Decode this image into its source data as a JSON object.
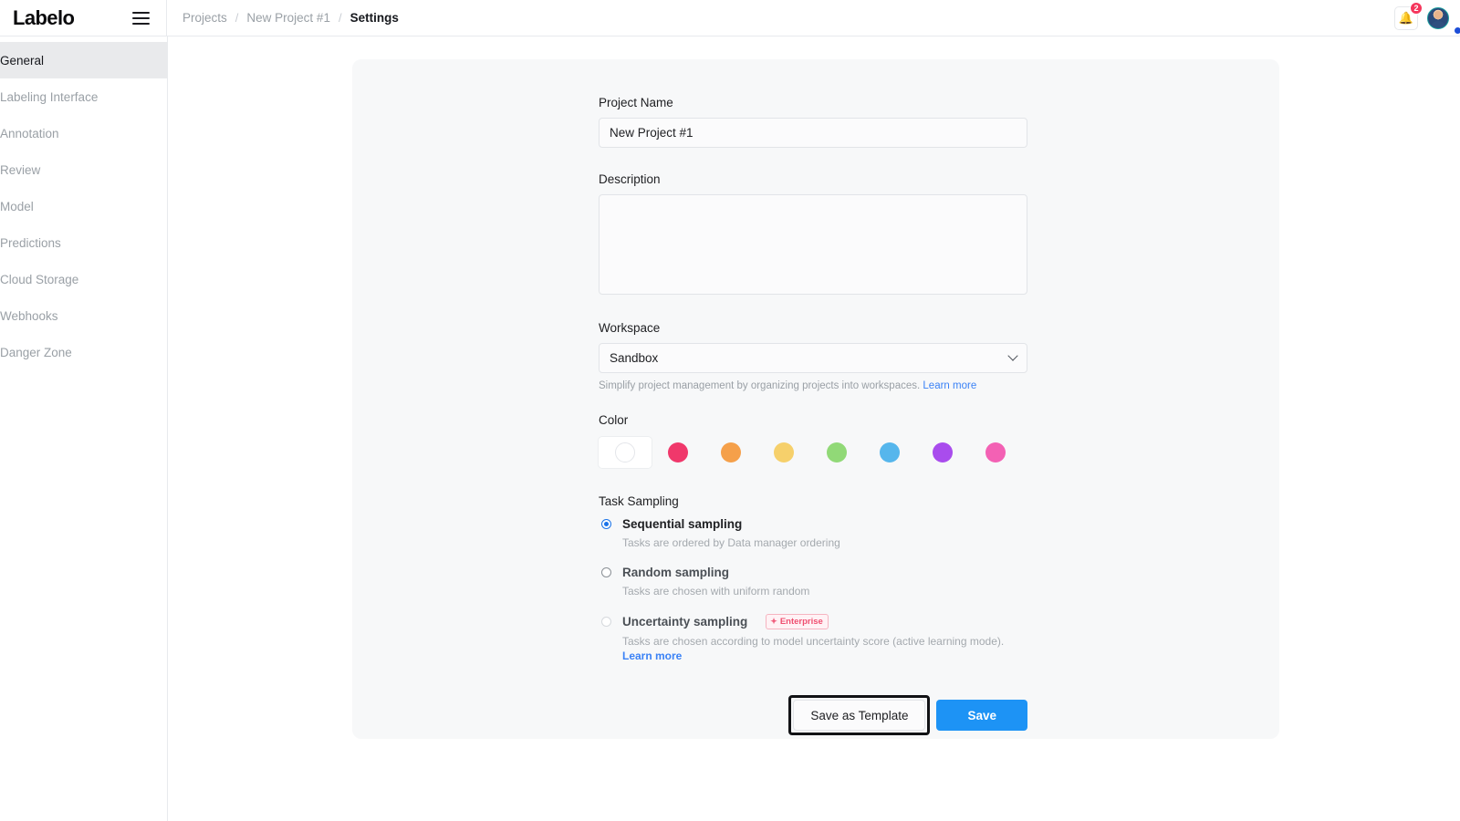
{
  "app": {
    "logo_text": "Labelo",
    "menu_icon": "hamburger-icon"
  },
  "breadcrumb": {
    "items": [
      {
        "label": "Projects",
        "current": false
      },
      {
        "label": "New Project #1",
        "current": false
      },
      {
        "label": "Settings",
        "current": true
      }
    ],
    "separator": "/"
  },
  "topbar": {
    "notifications_count": "2",
    "bell_icon": "bell-icon",
    "avatar_label": "user-avatar"
  },
  "sidebar": {
    "items": [
      {
        "label": "General",
        "active": true
      },
      {
        "label": "Labeling Interface",
        "active": false
      },
      {
        "label": "Annotation",
        "active": false
      },
      {
        "label": "Review",
        "active": false
      },
      {
        "label": "Model",
        "active": false
      },
      {
        "label": "Predictions",
        "active": false
      },
      {
        "label": "Cloud Storage",
        "active": false
      },
      {
        "label": "Webhooks",
        "active": false
      },
      {
        "label": "Danger Zone",
        "active": false
      }
    ]
  },
  "form": {
    "project_name": {
      "label": "Project Name",
      "value": "New Project #1",
      "placeholder": ""
    },
    "description": {
      "label": "Description",
      "value": "",
      "placeholder": ""
    },
    "workspace": {
      "label": "Workspace",
      "selected": "Sandbox",
      "options": [
        "Sandbox"
      ],
      "hint_text": "Simplify project management by organizing projects into workspaces.",
      "hint_link": "Learn more"
    },
    "color": {
      "label": "Color",
      "selected_index": 0,
      "swatches": [
        {
          "name": "none",
          "hex": "#ffffff"
        },
        {
          "name": "red",
          "hex": "#f0386b"
        },
        {
          "name": "orange",
          "hex": "#f5a04a"
        },
        {
          "name": "yellow",
          "hex": "#f6d06b"
        },
        {
          "name": "green",
          "hex": "#91d977"
        },
        {
          "name": "blue",
          "hex": "#56b6ec"
        },
        {
          "name": "purple",
          "hex": "#a94ced"
        },
        {
          "name": "pink",
          "hex": "#f361b4"
        }
      ]
    },
    "task_sampling": {
      "label": "Task Sampling",
      "options": [
        {
          "label": "Sequential sampling",
          "description": "Tasks are ordered by Data manager ordering",
          "selected": true,
          "disabled": false,
          "badge": null,
          "link": null
        },
        {
          "label": "Random sampling",
          "description": "Tasks are chosen with uniform random",
          "selected": false,
          "disabled": false,
          "badge": null,
          "link": null
        },
        {
          "label": "Uncertainty sampling",
          "description": "Tasks are chosen according to model uncertainty score (active learning mode).",
          "selected": false,
          "disabled": true,
          "badge": "Enterprise",
          "link": "Learn more"
        }
      ]
    },
    "actions": {
      "save_as_template": "Save as Template",
      "save": "Save",
      "focused": "save-as-template-button"
    }
  },
  "colors": {
    "accent": "#1d93f5",
    "badge_red": "#f5365c",
    "enterprise": "#ef4f70",
    "link": "#3b82f6"
  }
}
